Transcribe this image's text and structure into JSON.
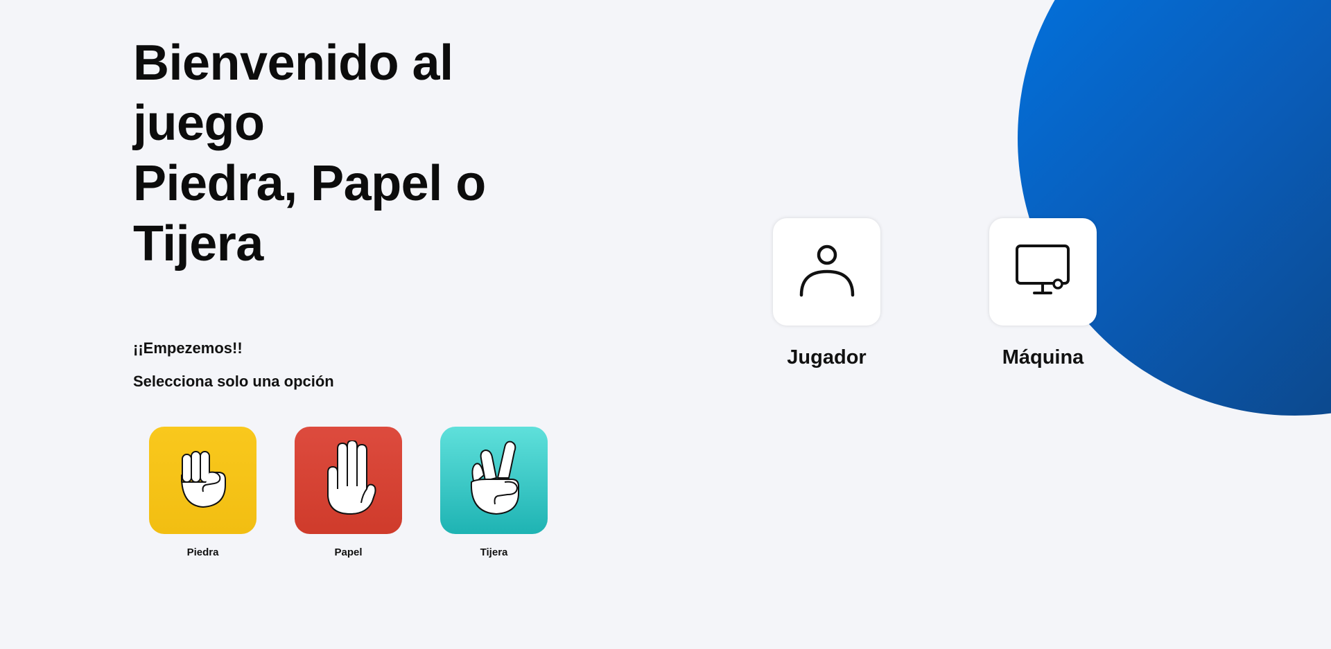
{
  "title_lines": [
    "Bienvenido al juego",
    "Piedra, Papel o",
    "Tijera"
  ],
  "intro": "¡¡Empezemos!!",
  "instruction": "Selecciona solo una opción",
  "choices": [
    {
      "label": "Piedra",
      "icon": "rock-hand-icon",
      "color": "#f5c518"
    },
    {
      "label": "Papel",
      "icon": "paper-hand-icon",
      "color": "#d6412f"
    },
    {
      "label": "Tijera",
      "icon": "scissors-hand-icon",
      "color": "#36c5c5"
    }
  ],
  "players": [
    {
      "label": "Jugador",
      "icon": "user-icon"
    },
    {
      "label": "Máquina",
      "icon": "computer-icon"
    }
  ],
  "colors": {
    "background": "#f4f5f9",
    "accent_circle_start": "#0077e6",
    "accent_circle_end": "#0d3d73"
  }
}
